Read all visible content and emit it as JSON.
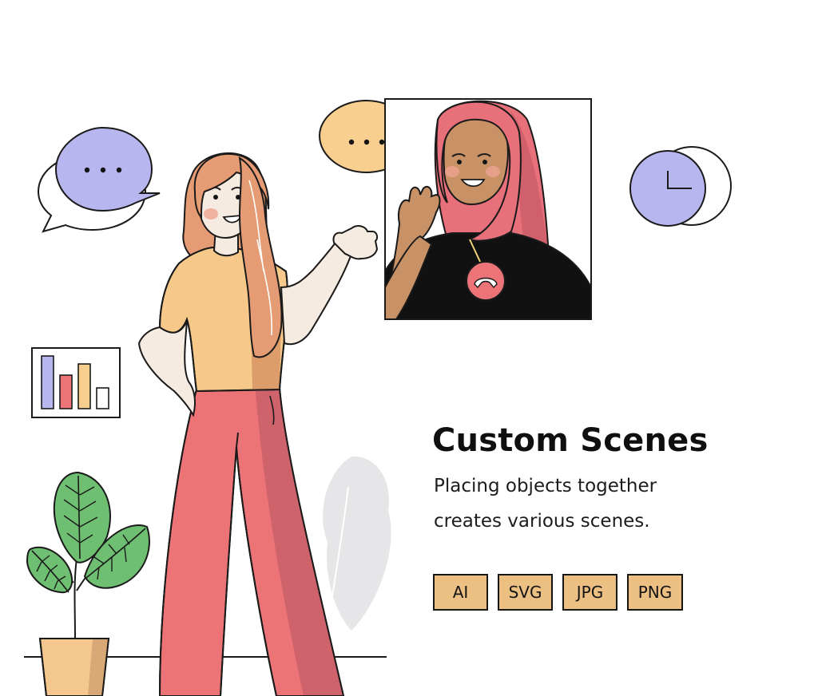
{
  "heading": {
    "title": "Custom Scenes",
    "line1": "Placing objects together",
    "line2": "creates various scenes."
  },
  "formats": [
    {
      "label": "AI"
    },
    {
      "label": "SVG"
    },
    {
      "label": "JPG"
    },
    {
      "label": "PNG"
    }
  ],
  "colors": {
    "bubble_purple": "#b8b6ef",
    "bubble_peach": "#f8cf8f",
    "skin_light": "#f6ebe0",
    "skin_dark": "#c99266",
    "hair": "#e59b74",
    "hijab": "#e8707a",
    "shirt": "#f6c98b",
    "pants": "#ec7477",
    "leaf": "#6fbf72",
    "pot": "#f3c78d",
    "badge": "#ecbf83"
  },
  "icons": [
    "speech-bubble-icon",
    "chat-bubble-icon",
    "clock-icon",
    "bar-chart-icon",
    "hang-up-icon",
    "plant-icon"
  ]
}
